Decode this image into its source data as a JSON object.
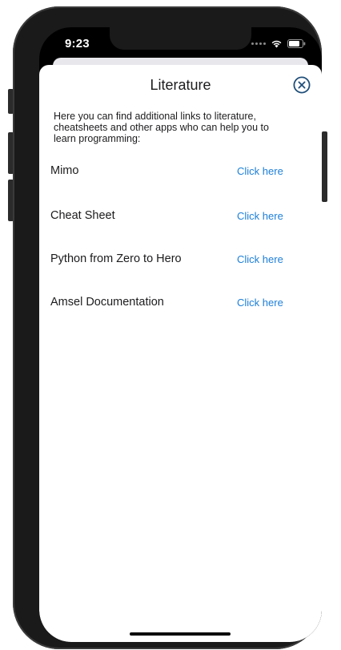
{
  "status_bar": {
    "time": "9:23",
    "icons": [
      "signal-icon",
      "wifi-icon",
      "battery-icon"
    ]
  },
  "sheet": {
    "title": "Literature",
    "close_icon": "close-circle-icon",
    "intro": "Here you can find additional links to literature, cheatsheets and other apps who can help you to learn programming:",
    "items": [
      {
        "label": "Mimo",
        "link": "Click here"
      },
      {
        "label": "Cheat Sheet",
        "link": "Click here"
      },
      {
        "label": "Python from Zero to Hero",
        "link": "Click here"
      },
      {
        "label": "Amsel Documentation",
        "link": "Click here"
      }
    ]
  },
  "colors": {
    "link": "#1c7fd9",
    "close_icon": "#1f4e79",
    "text": "#1c1c1e",
    "frame": "#1a1a1a"
  }
}
